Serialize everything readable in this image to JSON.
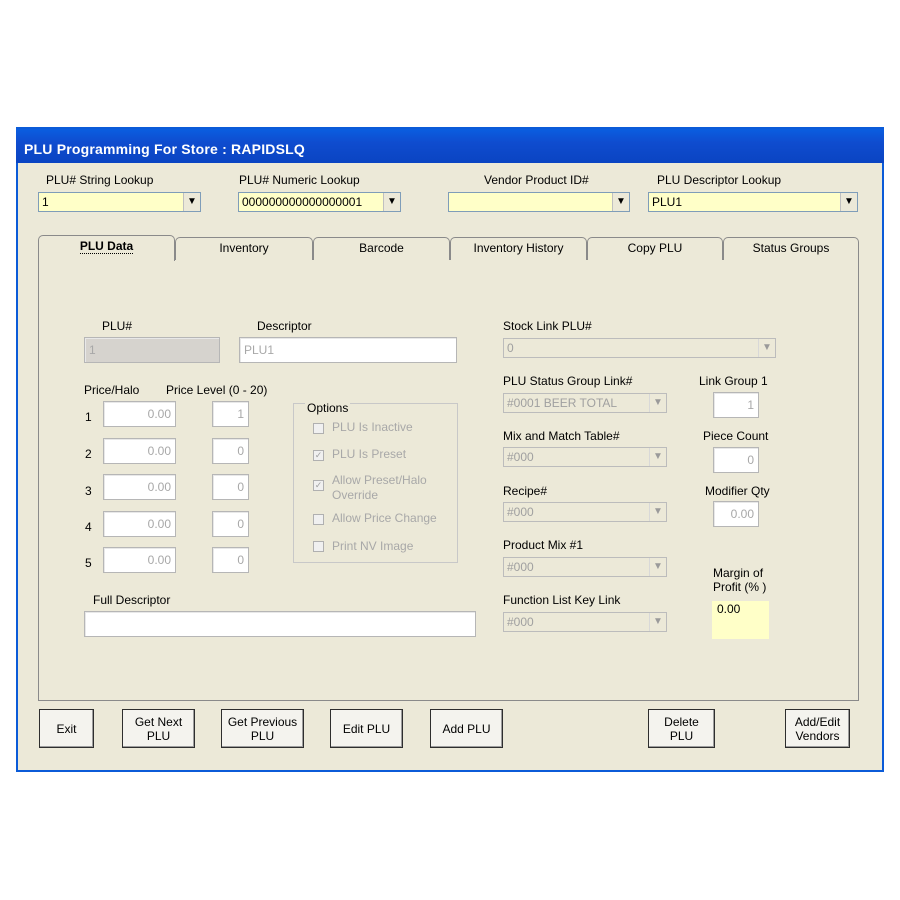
{
  "window": {
    "title": "PLU Programming For Store :  RAPIDSLQ"
  },
  "lookups": {
    "string_label": "PLU# String  Lookup",
    "string_value": "1",
    "numeric_label": "PLU# Numeric  Lookup",
    "numeric_value": "000000000000000001",
    "vendor_label": "Vendor Product ID#",
    "vendor_value": "",
    "descriptor_label": "PLU Descriptor Lookup",
    "descriptor_value": "PLU1"
  },
  "tabs": [
    "PLU Data",
    "Inventory",
    "Barcode",
    "Inventory History",
    "Copy PLU",
    "Status Groups"
  ],
  "plu": {
    "plu_label": "PLU#",
    "plu_value": "1",
    "descriptor_label": "Descriptor",
    "descriptor_value": "PLU1",
    "price_label": "Price/Halo",
    "level_label": "Price Level (0 - 20)",
    "rows": [
      {
        "n": "1",
        "price": "0.00",
        "level": "1"
      },
      {
        "n": "2",
        "price": "0.00",
        "level": "0"
      },
      {
        "n": "3",
        "price": "0.00",
        "level": "0"
      },
      {
        "n": "4",
        "price": "0.00",
        "level": "0"
      },
      {
        "n": "5",
        "price": "0.00",
        "level": "0"
      }
    ],
    "full_descriptor_label": "Full Descriptor",
    "full_descriptor_value": ""
  },
  "options": {
    "label": "Options",
    "items": [
      {
        "label": "PLU Is Inactive",
        "checked": false
      },
      {
        "label": "PLU Is Preset",
        "checked": true
      },
      {
        "label": "Allow Preset/Halo",
        "label2": "Override",
        "checked": true
      },
      {
        "label": "Allow Price Change",
        "checked": false
      },
      {
        "label": "Print NV Image",
        "checked": false
      }
    ]
  },
  "right": {
    "stock_link_label": "Stock Link PLU#",
    "stock_link_value": "0",
    "status_group_label": "PLU Status Group Link#",
    "status_group_value": "#0001  BEER TOTAL",
    "mix_label": "Mix and Match Table#",
    "mix_value": "#000",
    "recipe_label": "Recipe#",
    "recipe_value": "#000",
    "product_mix_label": "Product Mix #1",
    "product_mix_value": "#000",
    "function_label": "Function List Key Link",
    "function_value": "#000",
    "link_group_label": "Link Group 1",
    "link_group_value": "1",
    "piece_count_label": "Piece Count",
    "piece_count_value": "0",
    "modifier_label": "Modifier Qty",
    "modifier_value": "0.00",
    "margin_label1": "Margin of",
    "margin_label2": "Profit (% )",
    "margin_value": "0.00"
  },
  "buttons": {
    "exit": "Exit",
    "get_next_1": "Get Next",
    "get_next_2": "PLU",
    "get_prev_1": "Get Previous",
    "get_prev_2": "PLU",
    "edit": "Edit PLU",
    "add": "Add PLU",
    "delete_1": "Delete",
    "delete_2": "PLU",
    "vendors_1": "Add/Edit",
    "vendors_2": "Vendors"
  },
  "icons": {
    "dropdown": "chevron-down-icon",
    "checkbox": "checkbox-icon"
  }
}
